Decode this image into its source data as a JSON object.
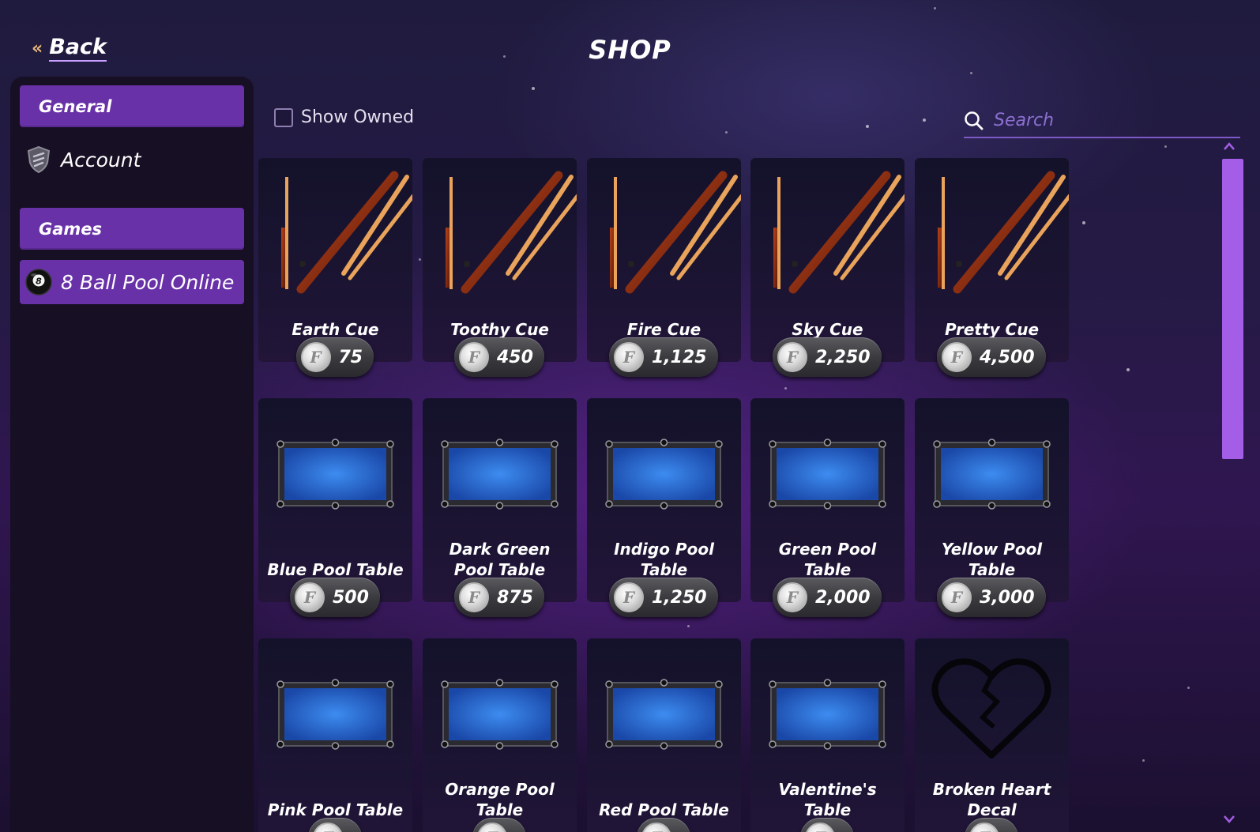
{
  "header": {
    "back_label": "Back",
    "title": "SHOP"
  },
  "sidebar": {
    "sections": [
      {
        "label": "General",
        "items": [
          {
            "label": "Account",
            "icon": "shield-icon",
            "active": false
          }
        ]
      },
      {
        "label": "Games",
        "items": [
          {
            "label": "8 Ball Pool Online",
            "icon": "eight-ball-icon",
            "active": true
          }
        ]
      }
    ]
  },
  "filters": {
    "show_owned_label": "Show Owned",
    "show_owned_checked": false,
    "search_placeholder": "Search"
  },
  "items": [
    {
      "name": "Earth Cue",
      "price": "75",
      "kind": "cue",
      "colors": [
        "#b8431c",
        "#5e1a08"
      ]
    },
    {
      "name": "Toothy Cue",
      "price": "450",
      "kind": "cue",
      "colors": [
        "#ff8a1f",
        "#c23c06"
      ]
    },
    {
      "name": "Fire Cue",
      "price": "1,125",
      "kind": "cue",
      "colors": [
        "#ffc02a",
        "#d6400e"
      ]
    },
    {
      "name": "Sky Cue",
      "price": "2,250",
      "kind": "cue",
      "colors": [
        "#a9d3e8",
        "#4d7e98"
      ]
    },
    {
      "name": "Pretty Cue",
      "price": "4,500",
      "kind": "cue",
      "colors": [
        "#6c7fd8",
        "#e0673a"
      ]
    },
    {
      "name": "Blue Pool Table",
      "price": "500",
      "kind": "table",
      "colors": [
        "#3d8cf0",
        "#1a48a8"
      ]
    },
    {
      "name": "Dark Green Pool Table",
      "price": "875",
      "kind": "table",
      "colors": [
        "#1aa24a",
        "#0a5a24"
      ]
    },
    {
      "name": "Indigo Pool Table",
      "price": "1,250",
      "kind": "table",
      "colors": [
        "#6c46e6",
        "#3a1ea8"
      ]
    },
    {
      "name": "Green Pool Table",
      "price": "2,000",
      "kind": "table",
      "colors": [
        "#5ad43a",
        "#2b8a18"
      ]
    },
    {
      "name": "Yellow Pool Table",
      "price": "3,000",
      "kind": "table",
      "colors": [
        "#e8e23a",
        "#a0a014"
      ]
    },
    {
      "name": "Pink Pool Table",
      "price": "",
      "kind": "table",
      "colors": [
        "#e03ae8",
        "#8e1aa8"
      ]
    },
    {
      "name": "Orange Pool Table",
      "price": "",
      "kind": "table",
      "colors": [
        "#f07a2a",
        "#b0460e"
      ]
    },
    {
      "name": "Red Pool Table",
      "price": "",
      "kind": "table",
      "colors": [
        "#e22a2a",
        "#9a1014"
      ]
    },
    {
      "name": "Valentine's Table",
      "price": "",
      "kind": "table",
      "colors": [
        "#ff1a7a",
        "#b00a4a"
      ]
    },
    {
      "name": "Broken Heart Decal",
      "price": "",
      "kind": "decal",
      "colors": [
        "#0d0b14",
        "#000000"
      ]
    }
  ]
}
